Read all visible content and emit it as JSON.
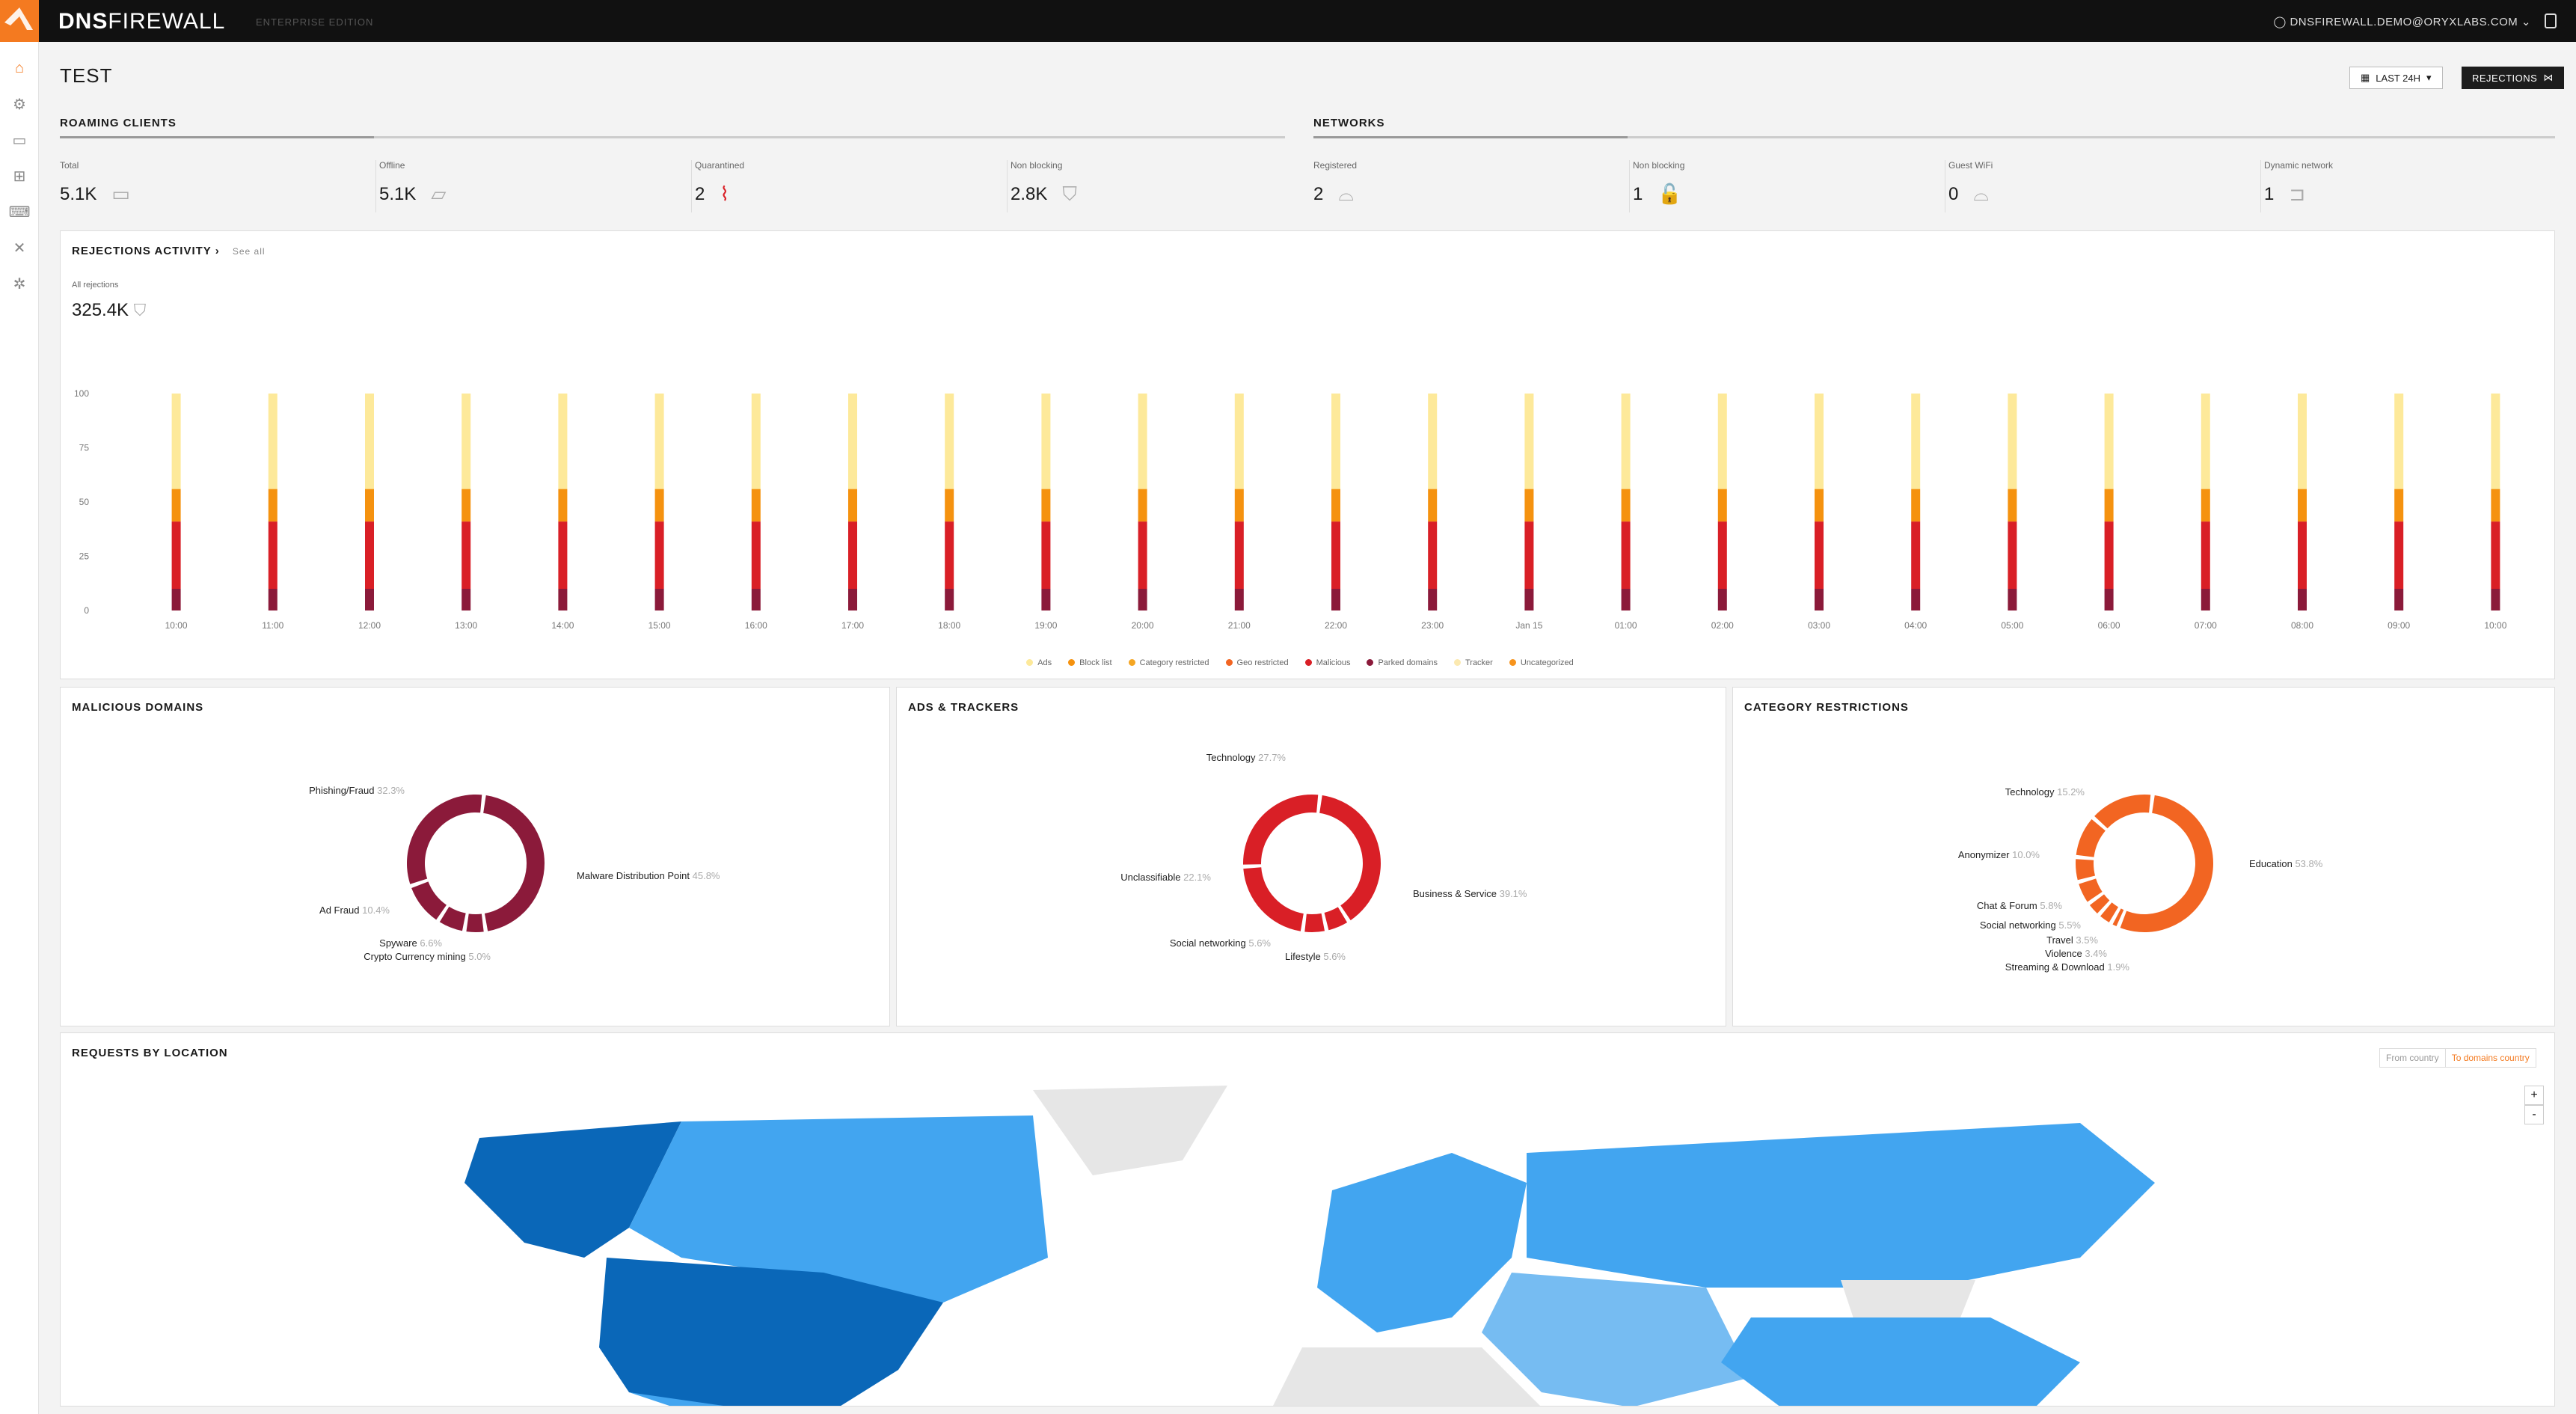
{
  "brand": {
    "name_bold": "DNS",
    "name_thin": "FIREWALL",
    "edition": "ENTERPRISE EDITION"
  },
  "user": {
    "email": "DNSFIREWALL.DEMO@ORYXLABS.COM"
  },
  "page": {
    "title": "TEST"
  },
  "toolbar": {
    "time_label": "LAST 24H",
    "rejections_label": "REJECTIONS"
  },
  "sections": {
    "roaming": "ROAMING CLIENTS",
    "networks": "NETWORKS"
  },
  "roaming_stats": [
    {
      "label": "Total",
      "value": "5.1K",
      "icon": "laptop-icon"
    },
    {
      "label": "Offline",
      "value": "5.1K",
      "icon": "laptop-off-icon"
    },
    {
      "label": "Quarantined",
      "value": "2",
      "icon": "wifi-off-icon"
    },
    {
      "label": "Non blocking",
      "value": "2.8K",
      "icon": "shield-icon"
    }
  ],
  "network_stats": [
    {
      "label": "Registered",
      "value": "2",
      "icon": "router-icon"
    },
    {
      "label": "Non blocking",
      "value": "1",
      "icon": "unlock-icon"
    },
    {
      "label": "Guest WiFi",
      "value": "0",
      "icon": "router-icon"
    },
    {
      "label": "Dynamic network",
      "value": "1",
      "icon": "lock-open-icon"
    }
  ],
  "activity": {
    "title": "REJECTIONS ACTIVITY",
    "see_all": "See all",
    "all_label": "All rejections",
    "all_value": "325.4K"
  },
  "colors": {
    "ads": "#fde99a",
    "blocklist": "#f5920f",
    "category": "#f5a623",
    "geo": "#f26522",
    "malicious": "#d91f26",
    "parked": "#8b1a3a",
    "tracker": "#fbe9b0",
    "uncategorized": "#f7941d",
    "map_dark": "#0a67b8",
    "map_mid": "#42a5f0",
    "map_light": "#76bcf2",
    "map_none": "#e6e6e6"
  },
  "chart_data": [
    {
      "type": "bar",
      "title": "REJECTIONS ACTIVITY",
      "ylim": [
        0,
        100
      ],
      "yticks": [
        0,
        25,
        50,
        75,
        100
      ],
      "categories": [
        "10:00",
        "11:00",
        "12:00",
        "13:00",
        "14:00",
        "15:00",
        "16:00",
        "17:00",
        "18:00",
        "19:00",
        "20:00",
        "21:00",
        "22:00",
        "23:00",
        "Jan 15",
        "01:00",
        "02:00",
        "03:00",
        "04:00",
        "05:00",
        "06:00",
        "07:00",
        "08:00",
        "09:00",
        "10:00"
      ],
      "legend": [
        "Ads",
        "Block list",
        "Category restricted",
        "Geo restricted",
        "Malicious",
        "Parked domains",
        "Tracker",
        "Uncategorized"
      ],
      "series": [
        {
          "name": "Parked domains",
          "values": [
            10,
            10,
            10,
            10,
            10,
            10,
            10,
            10,
            10,
            10,
            10,
            10,
            10,
            10,
            10,
            10,
            10,
            10,
            10,
            10,
            10,
            10,
            10,
            10,
            10
          ]
        },
        {
          "name": "Malicious",
          "values": [
            31,
            31,
            31,
            31,
            31,
            31,
            31,
            31,
            31,
            31,
            31,
            31,
            31,
            31,
            31,
            31,
            31,
            31,
            31,
            31,
            31,
            31,
            31,
            31,
            31
          ]
        },
        {
          "name": "Block list",
          "values": [
            15,
            15,
            15,
            15,
            15,
            15,
            15,
            15,
            15,
            15,
            15,
            15,
            15,
            15,
            15,
            15,
            15,
            15,
            15,
            15,
            15,
            15,
            15,
            15,
            15
          ]
        },
        {
          "name": "Ads",
          "values": [
            44,
            44,
            44,
            44,
            44,
            44,
            44,
            44,
            44,
            44,
            44,
            44,
            44,
            44,
            44,
            44,
            44,
            44,
            44,
            44,
            44,
            44,
            44,
            44,
            44
          ]
        }
      ]
    },
    {
      "type": "pie",
      "title": "MALICIOUS DOMAINS",
      "slices": [
        {
          "label": "Malware Distribution Point",
          "pct": "45.8%",
          "value": 45.8
        },
        {
          "label": "Crypto Currency mining",
          "pct": "5.0%",
          "value": 5.0
        },
        {
          "label": "Spyware",
          "pct": "6.6%",
          "value": 6.6
        },
        {
          "label": "Ad Fraud",
          "pct": "10.4%",
          "value": 10.4
        },
        {
          "label": "Phishing/Fraud",
          "pct": "32.3%",
          "value": 32.3
        }
      ]
    },
    {
      "type": "pie",
      "title": "ADS & TRACKERS",
      "slices": [
        {
          "label": "Business & Service",
          "pct": "39.1%",
          "value": 39.1
        },
        {
          "label": "Lifestyle",
          "pct": "5.6%",
          "value": 5.6
        },
        {
          "label": "Social networking",
          "pct": "5.6%",
          "value": 5.6
        },
        {
          "label": "Unclassifiable",
          "pct": "22.1%",
          "value": 22.1
        },
        {
          "label": "Technology",
          "pct": "27.7%",
          "value": 27.7
        }
      ]
    },
    {
      "type": "pie",
      "title": "CATEGORY RESTRICTIONS",
      "slices": [
        {
          "label": "Education",
          "pct": "53.8%",
          "value": 53.8
        },
        {
          "label": "Streaming & Download",
          "pct": "1.9%",
          "value": 1.9
        },
        {
          "label": "Violence",
          "pct": "3.4%",
          "value": 3.4
        },
        {
          "label": "Travel",
          "pct": "3.5%",
          "value": 3.5
        },
        {
          "label": "Social networking",
          "pct": "5.5%",
          "value": 5.5
        },
        {
          "label": "Chat & Forum",
          "pct": "5.8%",
          "value": 5.8
        },
        {
          "label": "Anonymizer",
          "pct": "10.0%",
          "value": 10.0
        },
        {
          "label": "Technology",
          "pct": "15.2%",
          "value": 15.2
        }
      ]
    }
  ],
  "panels": {
    "malicious": "MALICIOUS DOMAINS",
    "ads": "ADS & TRACKERS",
    "category": "CATEGORY RESTRICTIONS",
    "location": "REQUESTS BY LOCATION"
  },
  "location": {
    "from_label": "From country",
    "to_label": "To domains country",
    "zoom_in": "+",
    "zoom_out": "-"
  }
}
